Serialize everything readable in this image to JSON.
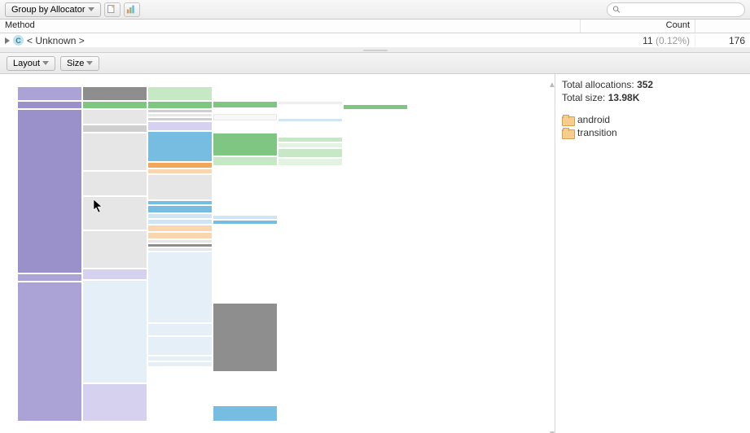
{
  "toolbar": {
    "group_by_label": "Group by Allocator",
    "search_placeholder": ""
  },
  "table": {
    "columns": {
      "c0": "Method",
      "c1": "Count"
    },
    "row0": {
      "method": "< Unknown >",
      "count_val": "11",
      "count_pct": "(0.12%)",
      "extra": "176"
    }
  },
  "sub_toolbar": {
    "layout_label": "Layout",
    "size_label": "Size"
  },
  "side": {
    "total_alloc_label": "Total allocations: ",
    "total_alloc_value": "352",
    "total_size_label": "Total size: ",
    "total_size_value": "13.98K",
    "items": [
      {
        "label": "android"
      },
      {
        "label": "transition"
      }
    ]
  },
  "icons": {
    "dropdown": "dropdown-triangle",
    "action1": "record-icon",
    "action2": "chart-icon",
    "search": "search-icon",
    "disclosure": "disclosure-triangle",
    "class": "class-c-icon",
    "package": "package-icon"
  }
}
